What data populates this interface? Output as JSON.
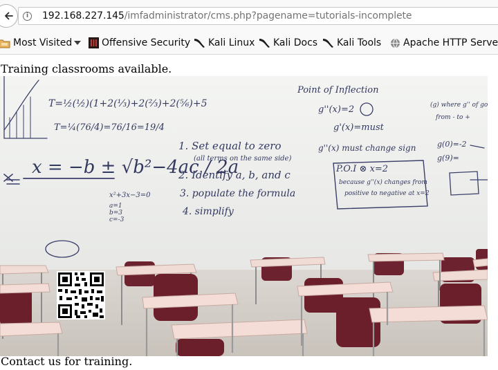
{
  "browser": {
    "url_host": "192.168.227.145",
    "url_path": "/imfadministrator/cms.php?pagename=tutorials-incomplete",
    "bookmarks": [
      {
        "label": "Most Visited",
        "icon": "folder-icon",
        "has_dropdown": true
      },
      {
        "label": "Offensive Security",
        "icon": "offsec-icon"
      },
      {
        "label": "Kali Linux",
        "icon": "kali-dragon-icon"
      },
      {
        "label": "Kali Docs",
        "icon": "kali-dragon-icon"
      },
      {
        "label": "Kali Tools",
        "icon": "kali-dragon-icon"
      },
      {
        "label": "Apache HTTP Server T",
        "icon": "globe-icon"
      }
    ]
  },
  "page": {
    "intro": "Training classrooms available.",
    "outro": "Contact us for training.",
    "hero": {
      "whiteboard": {
        "left_formulas": [
          "T=½(½)(1+2(⅓)+2(⅔)+2(⅚)+5",
          "T=¼(76/4)=76/16=19/4"
        ],
        "quadratic": "x = −b ± √b²−4ac / 2a",
        "quadratic_example": "x²+3x−3=0",
        "coeffs": [
          "a=1",
          "b=3",
          "c=-3"
        ],
        "steps": [
          "1. Set equal to zero",
          "(all terms on the same side)",
          "2. Identify a, b, and c",
          "3. populate the formula",
          "4. simplify"
        ],
        "inflection_title": "Point of Inflection",
        "inflection_lines": [
          "g''(x)=2",
          "g'(x)=must",
          "g''(x) must change sign",
          "P.O.I ⊗ x=2",
          "because g''(x) changes from",
          "positive to negative at x=2"
        ],
        "right_lines": [
          "(g) where g'' of goes",
          "from - to +",
          "g(0)=-2",
          "g(9)="
        ]
      }
    }
  },
  "colors": {
    "whiteboard": "#f2f3f1",
    "marker_ink": "#3a3f6a",
    "desk_top": "#f0d8d2",
    "chair": "#6a1f2a",
    "floor": "#d9d4cf"
  }
}
